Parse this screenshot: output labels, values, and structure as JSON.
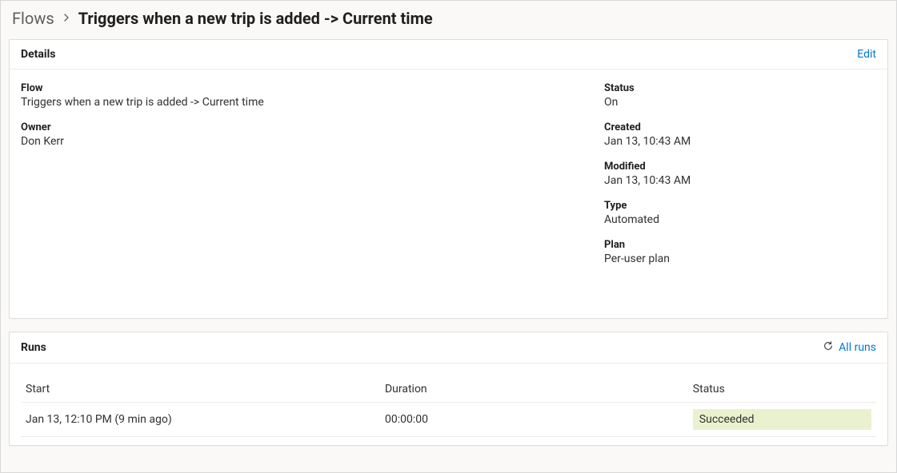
{
  "breadcrumb": {
    "root": "Flows",
    "current": "Triggers when a new trip is added -> Current time"
  },
  "details": {
    "title": "Details",
    "editLabel": "Edit",
    "flowLabel": "Flow",
    "flowValue": "Triggers when a new trip is added -> Current time",
    "ownerLabel": "Owner",
    "ownerValue": "Don Kerr",
    "statusLabel": "Status",
    "statusValue": "On",
    "createdLabel": "Created",
    "createdValue": "Jan 13, 10:43 AM",
    "modifiedLabel": "Modified",
    "modifiedValue": "Jan 13, 10:43 AM",
    "typeLabel": "Type",
    "typeValue": "Automated",
    "planLabel": "Plan",
    "planValue": "Per-user plan"
  },
  "runs": {
    "title": "Runs",
    "allRunsLabel": "All runs",
    "columns": {
      "start": "Start",
      "duration": "Duration",
      "status": "Status"
    },
    "row": {
      "start": "Jan 13, 12:10 PM (9 min ago)",
      "duration": "00:00:00",
      "status": "Succeeded"
    }
  }
}
